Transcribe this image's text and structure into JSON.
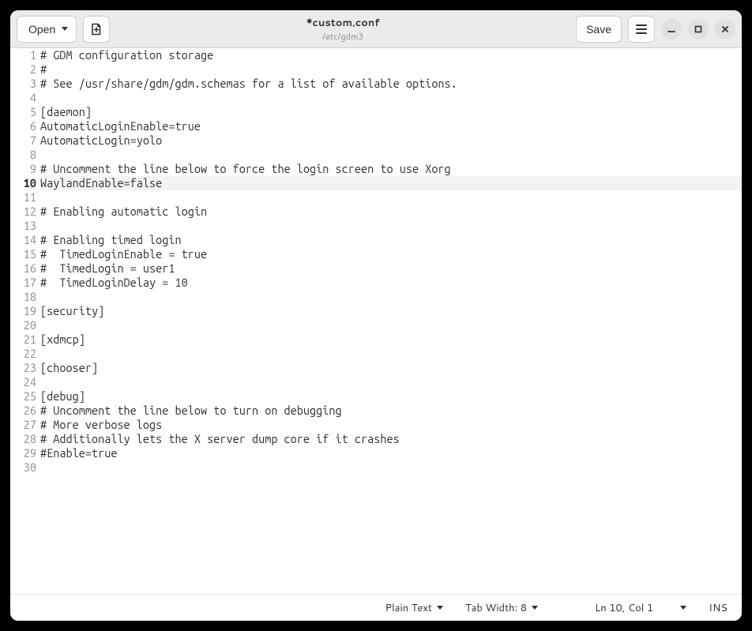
{
  "header": {
    "open_label": "Open",
    "save_label": "Save",
    "title": "*custom.conf",
    "subtitle": "/etc/gdm3"
  },
  "editor": {
    "current_line_index": 9,
    "lines": [
      "# GDM configuration storage",
      "#",
      "# See /usr/share/gdm/gdm.schemas for a list of available options.",
      "",
      "[daemon]",
      "AutomaticLoginEnable=true",
      "AutomaticLogin=yolo",
      "",
      "# Uncomment the line below to force the login screen to use Xorg",
      "WaylandEnable=false",
      "",
      "# Enabling automatic login",
      "",
      "# Enabling timed login",
      "#  TimedLoginEnable = true",
      "#  TimedLogin = user1",
      "#  TimedLoginDelay = 10",
      "",
      "[security]",
      "",
      "[xdmcp]",
      "",
      "[chooser]",
      "",
      "[debug]",
      "# Uncomment the line below to turn on debugging",
      "# More verbose logs",
      "# Additionally lets the X server dump core if it crashes",
      "#Enable=true",
      ""
    ]
  },
  "statusbar": {
    "syntax": "Plain Text",
    "tab_width": "Tab Width: 8",
    "position": "Ln 10, Col 1",
    "mode": "INS"
  }
}
